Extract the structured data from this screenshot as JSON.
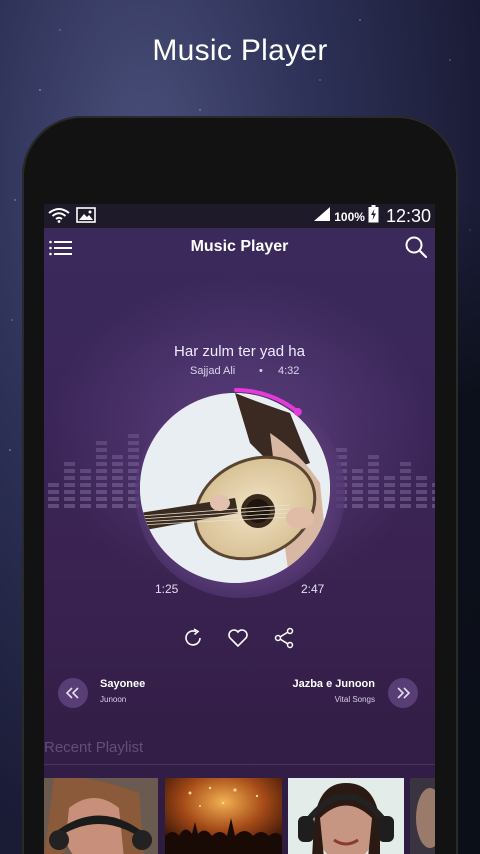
{
  "headline": "Music Player",
  "status_bar": {
    "wifi_icon": "wifi-icon",
    "image_icon": "image-icon",
    "signal_icon": "signal-icon",
    "battery_percent": "100%",
    "battery_icon": "battery-charging-icon",
    "time": "12:30"
  },
  "app_bar": {
    "menu_icon": "menu-icon",
    "title": "Music Player",
    "search_icon": "search-icon"
  },
  "now_playing": {
    "title": "Har zulm ter yad ha",
    "artist": "Sajjad Ali",
    "separator": "•",
    "duration": "4:32",
    "elapsed": "1:25",
    "remaining": "2:47",
    "progress": 0.31,
    "accent_color": "#e43ad8"
  },
  "actions": {
    "repeat_icon": "repeat-icon",
    "favorite_icon": "heart-icon",
    "share_icon": "share-icon"
  },
  "previous_track": {
    "icon": "rewind-icon",
    "title": "Sayonee",
    "artist": "Junoon"
  },
  "next_track": {
    "icon": "fast-forward-icon",
    "title": "Jazba e Junoon",
    "artist": "Vital Songs"
  },
  "recent_playlist": {
    "label": "Recent Playlist"
  }
}
